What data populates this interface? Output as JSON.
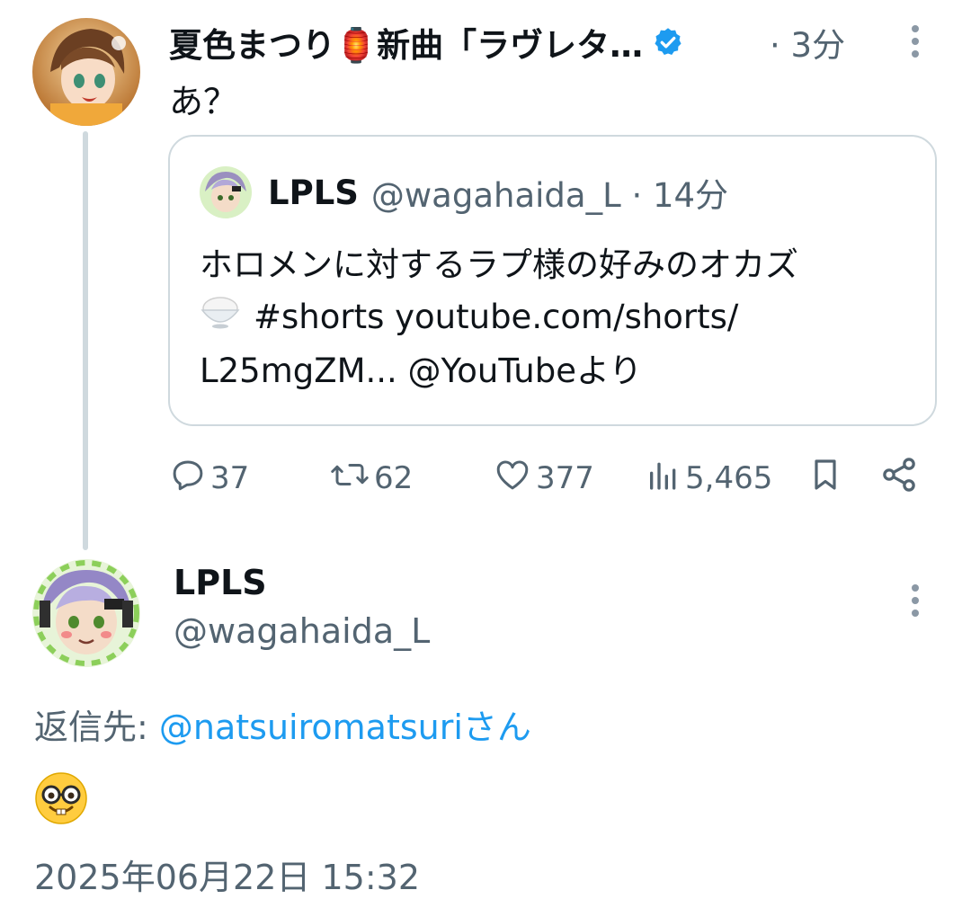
{
  "parent_tweet": {
    "author_name": "夏色まつり🏮新曲「ラヴレタ…",
    "time_ago": "· 3分",
    "text": "あ？",
    "verified": true
  },
  "quoted_tweet": {
    "author_name": "LPLS",
    "author_handle": "@wagahaida_L · 14分",
    "lines": [
      "ホロメンに対するラプ様の好みのオカズ",
      "#shorts youtube.com/shorts/",
      "L25mgZM... @YouTubeより"
    ]
  },
  "actions": {
    "replies": "37",
    "retweets": "62",
    "likes": "377",
    "views": "5,465"
  },
  "reply_tweet": {
    "author_name": "LPLS",
    "author_handle": "@wagahaida_L",
    "replying_label": "返信先: ",
    "replying_to": "@natsuiromatsuriさん",
    "timestamp": "2025年06月22日 15:32"
  },
  "colors": {
    "accent": "#1d9bf0",
    "muted": "#536471",
    "border": "#cfd9de"
  }
}
